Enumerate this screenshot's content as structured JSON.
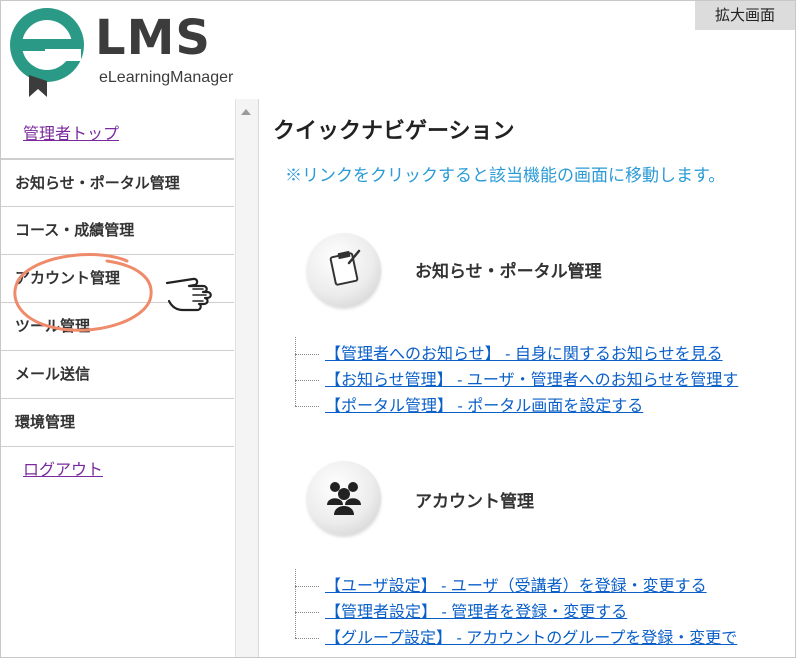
{
  "window": {
    "zoom_label": "拡大画面"
  },
  "logo": {
    "text": "LMS",
    "subtitle": "eLearningManager"
  },
  "sidebar": {
    "items": [
      {
        "label": "管理者トップ",
        "type": "link"
      },
      {
        "label": "お知らせ・ポータル管理",
        "type": "menu"
      },
      {
        "label": "コース・成績管理",
        "type": "menu"
      },
      {
        "label": "アカウント管理",
        "type": "menu"
      },
      {
        "label": "ツール管理",
        "type": "menu"
      },
      {
        "label": "メール送信",
        "type": "menu"
      },
      {
        "label": "環境管理",
        "type": "menu"
      },
      {
        "label": "ログアウト",
        "type": "link"
      }
    ]
  },
  "main": {
    "title": "クイックナビゲーション",
    "notice": "※リンクをクリックすると該当機能の画面に移動します。",
    "sections": [
      {
        "title": "お知らせ・ポータル管理",
        "icon": "clipboard-icon",
        "links": [
          "【管理者へのお知らせ】 - 自身に関するお知らせを見る",
          "【お知らせ管理】 - ユーザ・管理者へのお知らせを管理す",
          "【ポータル管理】 - ポータル画面を設定する"
        ]
      },
      {
        "title": "アカウント管理",
        "icon": "users-icon",
        "links": [
          "【ユーザ設定】 - ユーザ（受講者）を登録・変更する",
          "【管理者設定】 - 管理者を登録・変更する",
          "【グループ設定】 - アカウントのグループを登録・変更で"
        ]
      }
    ]
  },
  "annotations": {
    "highlight_color": "#ef8a6a",
    "pointer_icon": "pointing-hand-icon"
  }
}
